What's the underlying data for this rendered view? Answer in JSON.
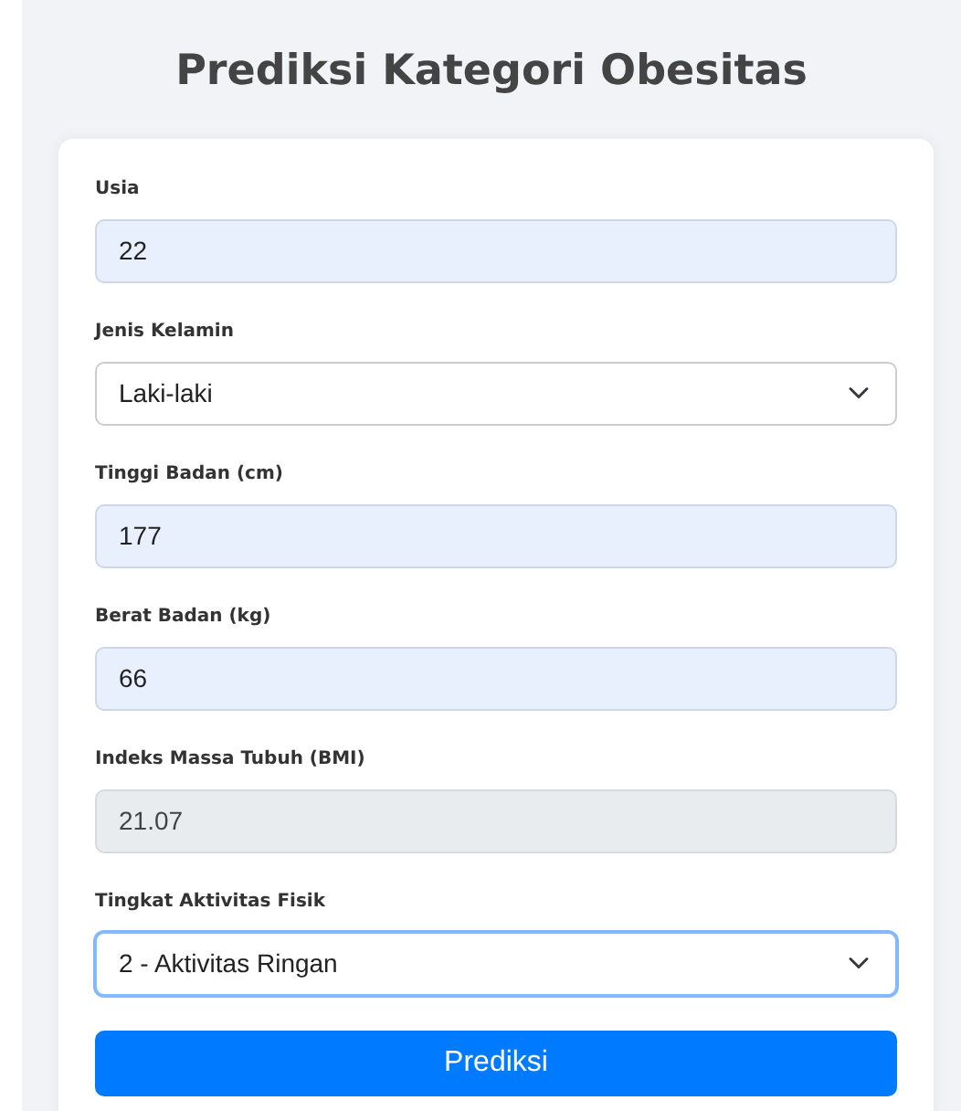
{
  "title": "Prediksi Kategori Obesitas",
  "fields": [
    {
      "label": "Usia",
      "kind": "input",
      "value": "22",
      "readonly": false,
      "focused": false
    },
    {
      "label": "Jenis Kelamin",
      "kind": "select",
      "value": "Laki-laki",
      "focused": false
    },
    {
      "label": "Tinggi Badan (cm)",
      "kind": "input",
      "value": "177",
      "readonly": false,
      "focused": false
    },
    {
      "label": "Berat Badan (kg)",
      "kind": "input",
      "value": "66",
      "readonly": false,
      "focused": false
    },
    {
      "label": "Indeks Massa Tubuh (BMI)",
      "kind": "input",
      "value": "21.07",
      "readonly": true,
      "focused": false
    },
    {
      "label": "Tingkat Aktivitas Fisik",
      "kind": "select",
      "value": "2 - Aktivitas Ringan",
      "focused": true
    }
  ],
  "button": "Prediksi"
}
